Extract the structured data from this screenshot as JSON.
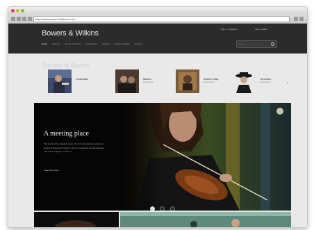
{
  "browser": {
    "url": "http://www.bowers-wilkins.co.uk/"
  },
  "site": {
    "logo": "Bowers & Wilkins",
    "top_links": [
      "Sign in / Register",
      "Find a dealer"
    ],
    "nav": [
      "Home",
      "Products",
      "Society of Sound",
      "Headphones",
      "Zeppelin",
      "Explore & Enjoy",
      "Support"
    ],
    "search_placeholder": "Search"
  },
  "section": {
    "title": "Society of Sound"
  },
  "artists": [
    {
      "name": "Custodian",
      "sub": ""
    },
    {
      "name": "Milano",
      "sub": "Recordings"
    },
    {
      "name": "Bowers Bay",
      "sub": "Recordings"
    },
    {
      "name": "Timbuktu",
      "sub": "Recordings"
    }
  ],
  "hero": {
    "title": "A meeting place",
    "body": "The world of live classical music, the rich and varied sounds and stories of those who create it, and the musicians and the listeners who come together to share it.",
    "link": "Read this article"
  },
  "carousel": {
    "count": 3,
    "active": 1
  },
  "colors": {
    "header": "#2b2b2b",
    "accent": "#ffffff",
    "page_bg": "#e9e9e9"
  }
}
